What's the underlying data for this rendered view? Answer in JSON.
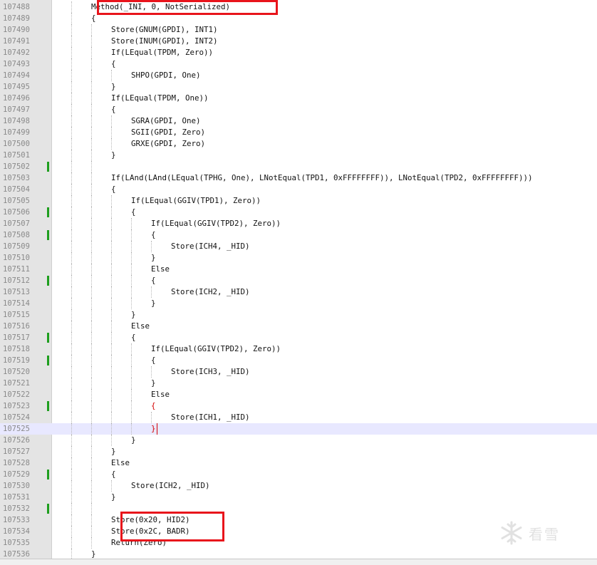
{
  "editor": {
    "lines": [
      {
        "num": "107488",
        "text": "Method(_INI, 0, NotSerialized)",
        "indent": 2,
        "changed": false
      },
      {
        "num": "107489",
        "text": "{",
        "indent": 2,
        "changed": false
      },
      {
        "num": "107490",
        "text": "Store(GNUM(GPDI), INT1)",
        "indent": 3,
        "changed": false
      },
      {
        "num": "107491",
        "text": "Store(INUM(GPDI), INT2)",
        "indent": 3,
        "changed": false
      },
      {
        "num": "107492",
        "text": "If(LEqual(TPDM, Zero))",
        "indent": 3,
        "changed": false
      },
      {
        "num": "107493",
        "text": "{",
        "indent": 3,
        "changed": false
      },
      {
        "num": "107494",
        "text": "SHPO(GPDI, One)",
        "indent": 4,
        "changed": false
      },
      {
        "num": "107495",
        "text": "}",
        "indent": 3,
        "changed": false
      },
      {
        "num": "107496",
        "text": "If(LEqual(TPDM, One))",
        "indent": 3,
        "changed": false
      },
      {
        "num": "107497",
        "text": "{",
        "indent": 3,
        "changed": false
      },
      {
        "num": "107498",
        "text": "SGRA(GPDI, One)",
        "indent": 4,
        "changed": false
      },
      {
        "num": "107499",
        "text": "SGII(GPDI, Zero)",
        "indent": 4,
        "changed": false
      },
      {
        "num": "107500",
        "text": "GRXE(GPDI, Zero)",
        "indent": 4,
        "changed": false
      },
      {
        "num": "107501",
        "text": "}",
        "indent": 3,
        "changed": false
      },
      {
        "num": "107502",
        "text": "",
        "indent": 3,
        "changed": true
      },
      {
        "num": "107503",
        "text": "If(LAnd(LAnd(LEqual(TPHG, One), LNotEqual(TPD1, 0xFFFFFFFF)), LNotEqual(TPD2, 0xFFFFFFFF)))",
        "indent": 3,
        "changed": false
      },
      {
        "num": "107504",
        "text": "{",
        "indent": 3,
        "changed": false
      },
      {
        "num": "107505",
        "text": "If(LEqual(GGIV(TPD1), Zero))",
        "indent": 4,
        "changed": false
      },
      {
        "num": "107506",
        "text": "{",
        "indent": 4,
        "changed": true
      },
      {
        "num": "107507",
        "text": "If(LEqual(GGIV(TPD2), Zero))",
        "indent": 5,
        "changed": false
      },
      {
        "num": "107508",
        "text": "{",
        "indent": 5,
        "changed": true
      },
      {
        "num": "107509",
        "text": "Store(ICH4, _HID)",
        "indent": 6,
        "changed": false
      },
      {
        "num": "107510",
        "text": "}",
        "indent": 5,
        "changed": false
      },
      {
        "num": "107511",
        "text": "Else",
        "indent": 5,
        "changed": false
      },
      {
        "num": "107512",
        "text": "{",
        "indent": 5,
        "changed": true
      },
      {
        "num": "107513",
        "text": "Store(ICH2, _HID)",
        "indent": 6,
        "changed": false
      },
      {
        "num": "107514",
        "text": "}",
        "indent": 5,
        "changed": false
      },
      {
        "num": "107515",
        "text": "}",
        "indent": 4,
        "changed": false
      },
      {
        "num": "107516",
        "text": "Else",
        "indent": 4,
        "changed": false
      },
      {
        "num": "107517",
        "text": "{",
        "indent": 4,
        "changed": true
      },
      {
        "num": "107518",
        "text": "If(LEqual(GGIV(TPD2), Zero))",
        "indent": 5,
        "changed": false
      },
      {
        "num": "107519",
        "text": "{",
        "indent": 5,
        "changed": true
      },
      {
        "num": "107520",
        "text": "Store(ICH3, _HID)",
        "indent": 6,
        "changed": false
      },
      {
        "num": "107521",
        "text": "}",
        "indent": 5,
        "changed": false
      },
      {
        "num": "107522",
        "text": "Else",
        "indent": 5,
        "changed": false
      },
      {
        "num": "107523",
        "text": "{",
        "indent": 5,
        "changed": true,
        "red": true
      },
      {
        "num": "107524",
        "text": "Store(ICH1, _HID)",
        "indent": 6,
        "changed": false
      },
      {
        "num": "107525",
        "text": "}",
        "indent": 5,
        "changed": false,
        "red": true,
        "current": true
      },
      {
        "num": "107526",
        "text": "}",
        "indent": 4,
        "changed": false
      },
      {
        "num": "107527",
        "text": "}",
        "indent": 3,
        "changed": false
      },
      {
        "num": "107528",
        "text": "Else",
        "indent": 3,
        "changed": false
      },
      {
        "num": "107529",
        "text": "{",
        "indent": 3,
        "changed": true
      },
      {
        "num": "107530",
        "text": "Store(ICH2, _HID)",
        "indent": 4,
        "changed": false
      },
      {
        "num": "107531",
        "text": "}",
        "indent": 3,
        "changed": false
      },
      {
        "num": "107532",
        "text": "",
        "indent": 3,
        "changed": true
      },
      {
        "num": "107533",
        "text": "Store(0x20, HID2)",
        "indent": 3,
        "changed": false
      },
      {
        "num": "107534",
        "text": "Store(0x2C, BADR)",
        "indent": 3,
        "changed": false
      },
      {
        "num": "107535",
        "text": "Return(Zero)",
        "indent": 3,
        "changed": false
      },
      {
        "num": "107536",
        "text": "}",
        "indent": 2,
        "changed": false
      }
    ]
  },
  "watermark": {
    "text": "看雪",
    "icon": "snowflake-icon"
  },
  "colors": {
    "highlight_box": "#e8141b",
    "change_marker": "#1e9e1e",
    "current_line": "#e8e8ff",
    "brace_match": "#d40000"
  }
}
